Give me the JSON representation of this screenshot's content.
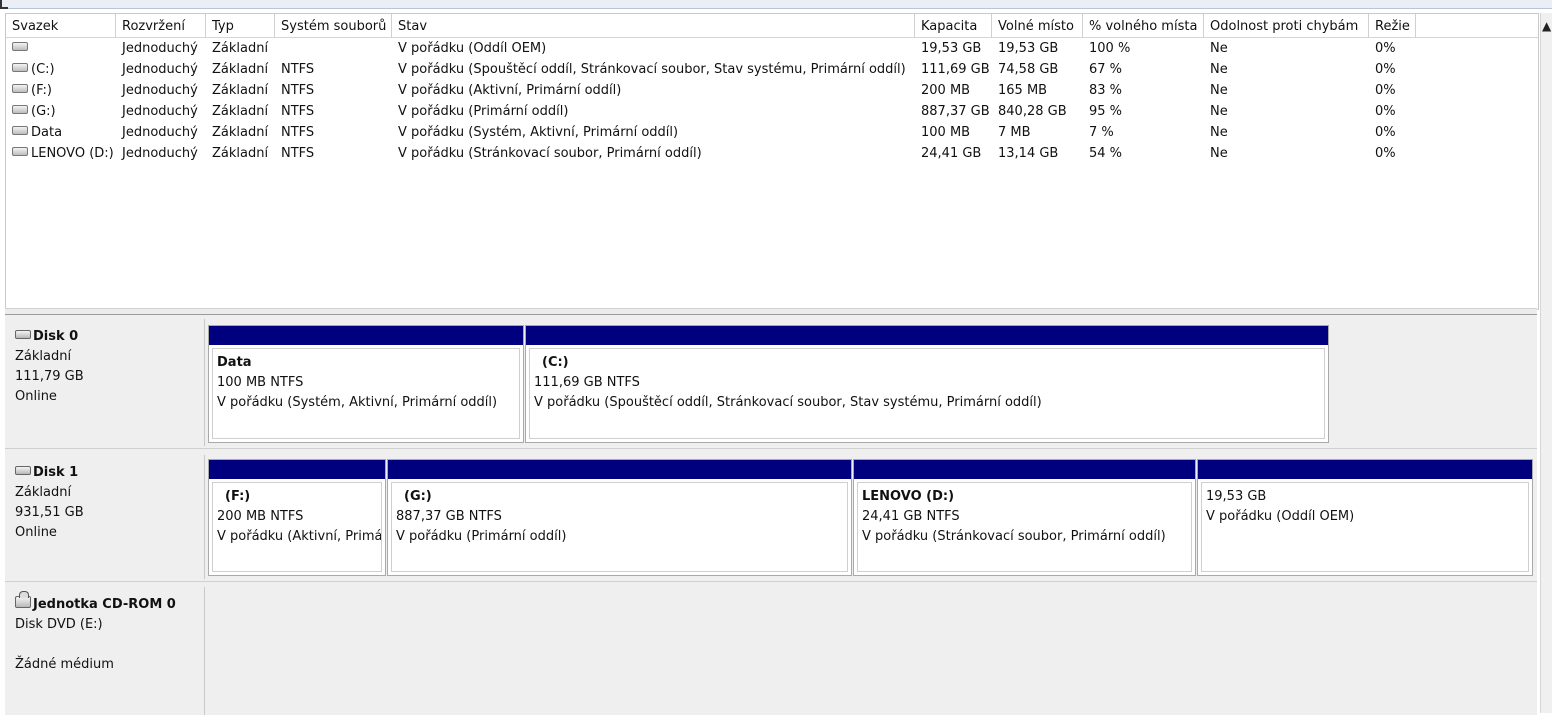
{
  "volume_list": {
    "columns": [
      "Svazek",
      "Rozvržení",
      "Typ",
      "Systém souborů",
      "Stav",
      "Kapacita",
      "Volné místo",
      "% volného místa",
      "Odolnost proti chybám",
      "Režie"
    ],
    "rows": [
      {
        "volume": "",
        "layout": "Jednoduchý",
        "type": "Základní",
        "fs": "",
        "status": "V pořádku (Oddíl OEM)",
        "capacity": "19,53 GB",
        "free": "19,53 GB",
        "pct_free": "100 %",
        "fault_tolerance": "Ne",
        "overhead": "0%"
      },
      {
        "volume": "(C:)",
        "layout": "Jednoduchý",
        "type": "Základní",
        "fs": "NTFS",
        "status": "V pořádku (Spouštěcí oddíl, Stránkovací soubor, Stav systému, Primární oddíl)",
        "capacity": "111,69 GB",
        "free": "74,58 GB",
        "pct_free": "67 %",
        "fault_tolerance": "Ne",
        "overhead": "0%"
      },
      {
        "volume": "(F:)",
        "layout": "Jednoduchý",
        "type": "Základní",
        "fs": "NTFS",
        "status": "V pořádku (Aktivní, Primární oddíl)",
        "capacity": "200 MB",
        "free": "165 MB",
        "pct_free": "83 %",
        "fault_tolerance": "Ne",
        "overhead": "0%"
      },
      {
        "volume": "(G:)",
        "layout": "Jednoduchý",
        "type": "Základní",
        "fs": "NTFS",
        "status": "V pořádku (Primární oddíl)",
        "capacity": "887,37 GB",
        "free": "840,28 GB",
        "pct_free": "95 %",
        "fault_tolerance": "Ne",
        "overhead": "0%"
      },
      {
        "volume": "Data",
        "layout": "Jednoduchý",
        "type": "Základní",
        "fs": "NTFS",
        "status": "V pořádku (Systém, Aktivní, Primární oddíl)",
        "capacity": "100 MB",
        "free": "7 MB",
        "pct_free": "7 %",
        "fault_tolerance": "Ne",
        "overhead": "0%"
      },
      {
        "volume": "LENOVO (D:)",
        "layout": "Jednoduchý",
        "type": "Základní",
        "fs": "NTFS",
        "status": "V pořádku (Stránkovací soubor, Primární oddíl)",
        "capacity": "24,41 GB",
        "free": "13,14 GB",
        "pct_free": "54 %",
        "fault_tolerance": "Ne",
        "overhead": "0%"
      }
    ]
  },
  "disks": [
    {
      "name": "Disk 0",
      "type": "Základní",
      "size": "111,79 GB",
      "state": "Online",
      "partitions": [
        {
          "title": "Data",
          "size_fs": "100 MB NTFS",
          "status": "V pořádku (Systém, Aktivní, Primární oddíl)"
        },
        {
          "title": "(C:)",
          "size_fs": "111,69 GB NTFS",
          "status": "V pořádku (Spouštěcí oddíl, Stránkovací soubor, Stav systému, Primární oddíl)"
        }
      ]
    },
    {
      "name": "Disk 1",
      "type": "Základní",
      "size": "931,51 GB",
      "state": "Online",
      "partitions": [
        {
          "title": "(F:)",
          "size_fs": "200 MB NTFS",
          "status": "V pořádku (Aktivní, Primární oddíl)"
        },
        {
          "title": "(G:)",
          "size_fs": "887,37 GB NTFS",
          "status": "V pořádku (Primární oddíl)"
        },
        {
          "title": "LENOVO  (D:)",
          "size_fs": "24,41 GB NTFS",
          "status": "V pořádku (Stránkovací soubor, Primární oddíl)"
        },
        {
          "title": "",
          "size_fs": "19,53 GB",
          "status": "V pořádku (Oddíl OEM)"
        }
      ]
    }
  ],
  "cdrom": {
    "name": "Jednotka CD-ROM 0",
    "type": "Disk DVD (E:)",
    "state": "Žádné médium"
  },
  "colors": {
    "partition_bar": "#00007f",
    "panel_bg": "#efefef"
  },
  "icons": {
    "volume": "drive-icon",
    "disk": "disk-icon",
    "cdrom": "cdrom-icon"
  }
}
